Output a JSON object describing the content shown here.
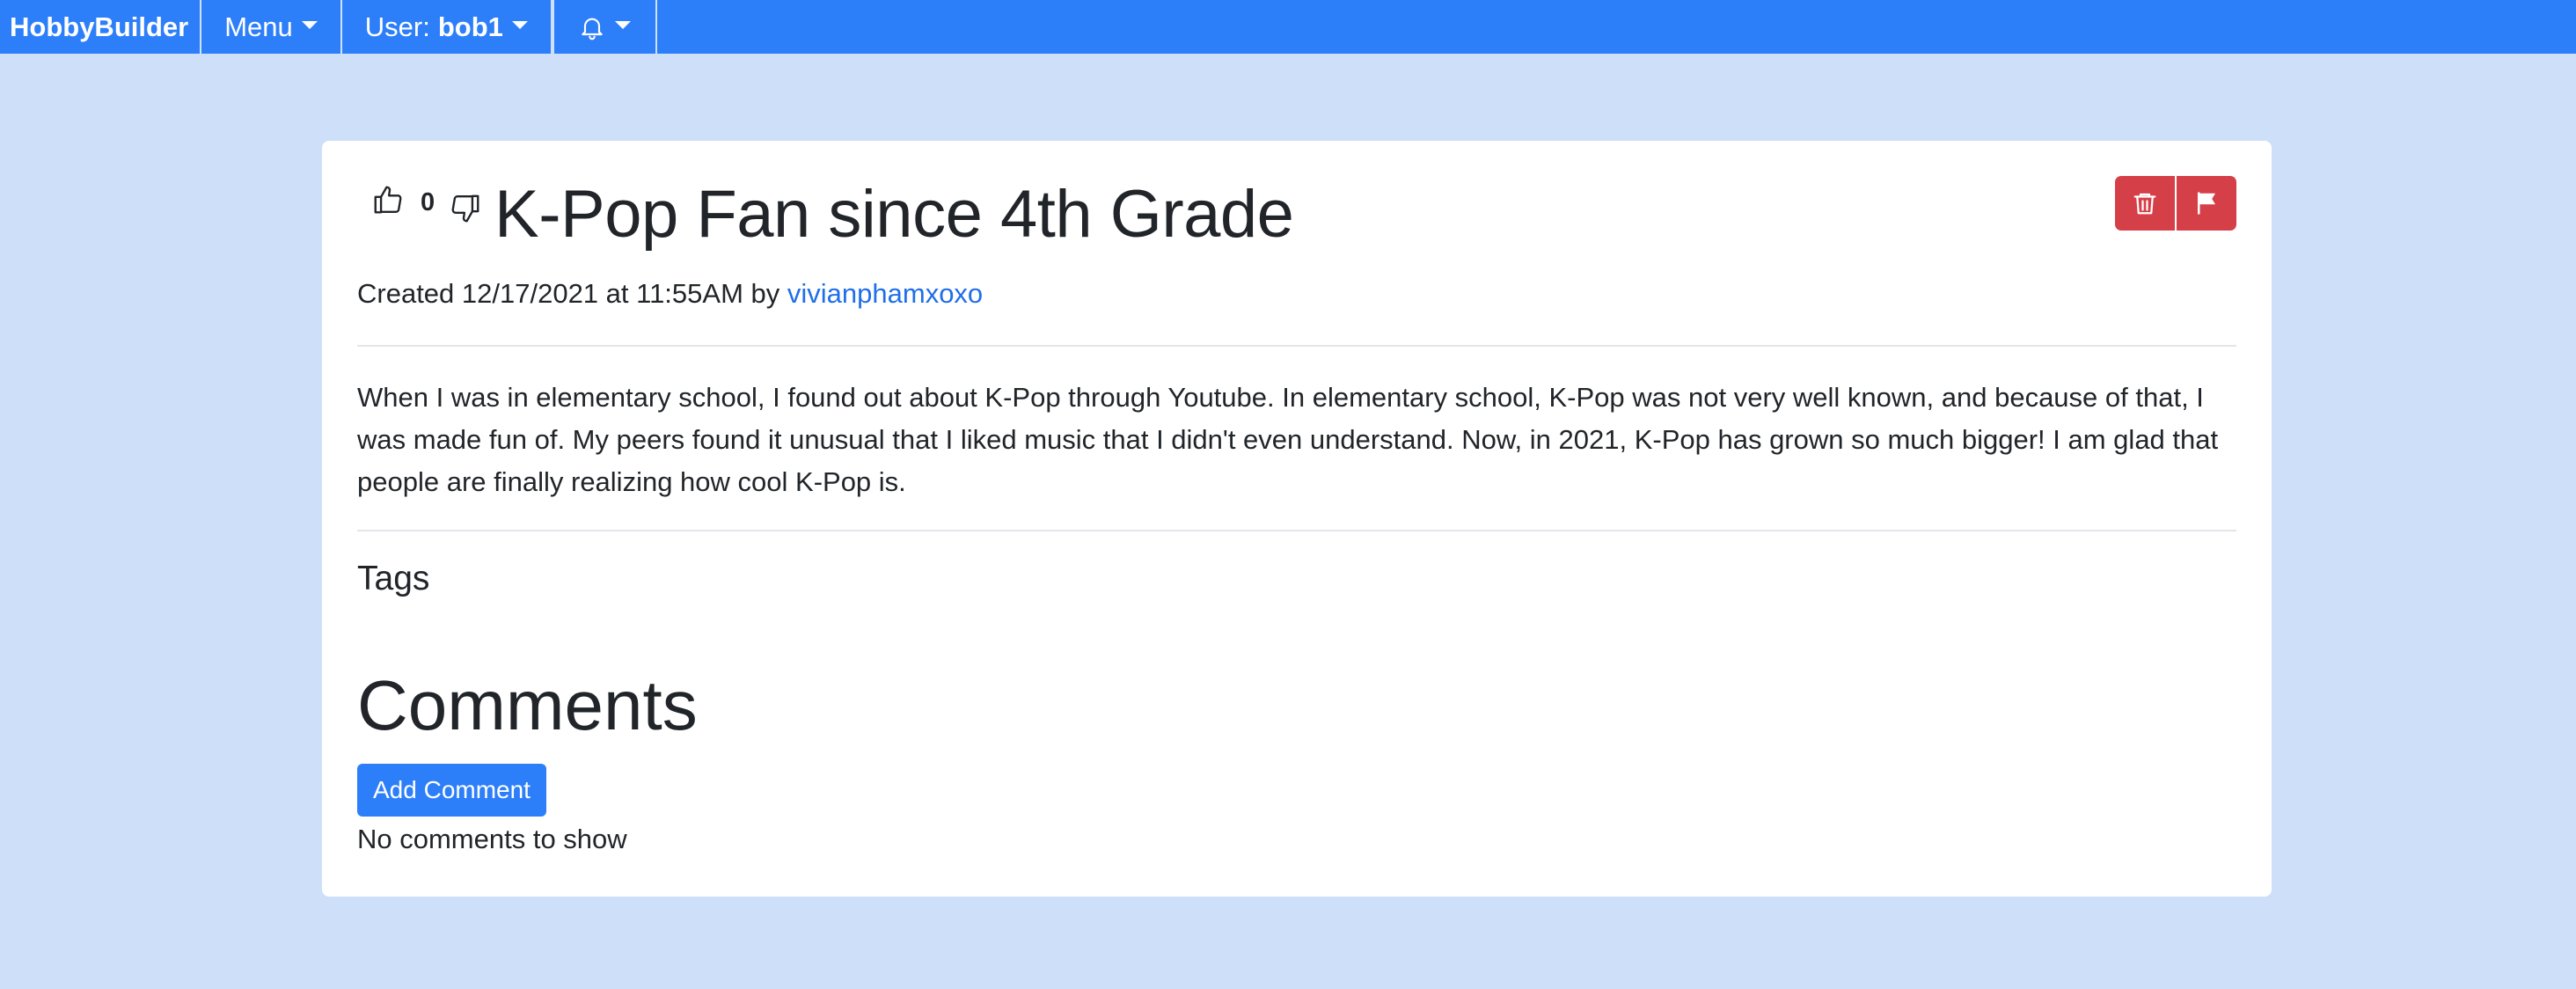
{
  "nav": {
    "brand": "HobbyBuilder",
    "menu_label": "Menu",
    "user_prefix": "User:",
    "username": "bob1",
    "bell_icon": "bell-icon"
  },
  "post": {
    "vote_count": "0",
    "title": "K-Pop Fan since 4th Grade",
    "created_prefix": "Created 12/17/2021 at 11:55AM by",
    "author": "vivianphamxoxo",
    "body": "When I was in elementary school, I found out about K-Pop through Youtube. In elementary school, K-Pop was not very well known, and because of that, I was made fun of. My peers found it unusual that I liked music that I didn't even understand. Now, in 2021, K-Pop has grown so much bigger! I am glad that people are finally realizing how cool K-Pop is.",
    "tags_heading": "Tags",
    "icons": [
      "thumbs-up-icon",
      "thumbs-down-icon",
      "trash-icon",
      "flag-icon"
    ]
  },
  "comments": {
    "heading": "Comments",
    "add_label": "Add Comment",
    "empty_text": "No comments to show"
  },
  "colors": {
    "navbar": "#2d7ff9",
    "page_bg": "#cddff9",
    "danger": "#d53f48",
    "link": "#1f6fe8"
  }
}
